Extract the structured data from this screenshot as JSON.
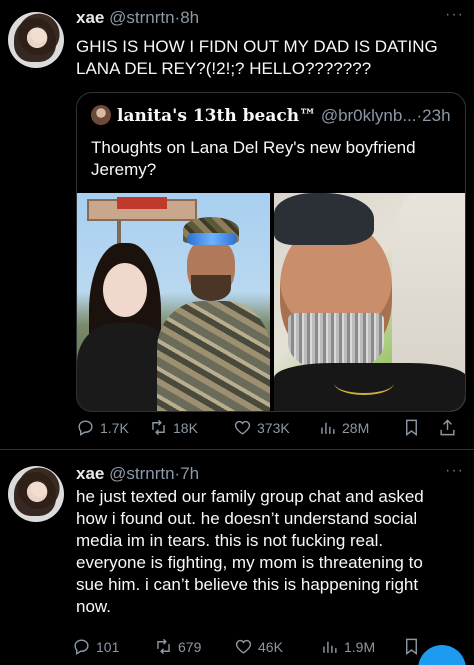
{
  "tweet1": {
    "name": "xae",
    "handle": "@strnrtn",
    "separator": "·",
    "time": "8h",
    "more": "···",
    "text_line1": "GHIS IS HOW I FIDN OUT MY DAD IS DATING",
    "text_line2": "LANA DEL REY?(!2!;? HELLO???????",
    "quote": {
      "name": "lanita's 13th beach™",
      "handle": "@br0klynb...",
      "separator": "·",
      "time": "23h",
      "text_line1": "Thoughts on Lana Del Rey's new boyfriend",
      "text_line2": "Jeremy?"
    },
    "stats": {
      "replies": "1.7K",
      "retweets": "18K",
      "likes": "373K",
      "views": "28M"
    }
  },
  "tweet2": {
    "name": "xae",
    "handle": "@strnrtn",
    "separator": "·",
    "time": "7h",
    "more": "···",
    "lines": [
      "he just texted our family group chat and asked",
      "how i found out. he doesn’t understand social",
      "media im in tears. this is not fucking real.",
      "everyone is fighting, my mom is threatening to",
      "sue him. i can’t believe this is happening right",
      "now."
    ],
    "stats": {
      "replies": "101",
      "retweets": "679",
      "likes": "46K",
      "views": "1.9M"
    }
  },
  "colors": {
    "background": "#000000",
    "text": "#e7e9ea",
    "muted": "#8b98a5",
    "border": "#2f3336",
    "accent": "#1d9bf0"
  },
  "icons": [
    "reply-icon",
    "retweet-icon",
    "like-icon",
    "views-icon",
    "bookmark-icon",
    "share-icon",
    "more-icon"
  ]
}
